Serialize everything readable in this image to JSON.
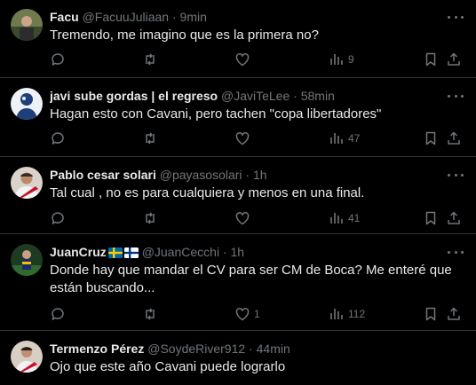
{
  "replies": [
    {
      "name": "Facu",
      "handle": "@FacuuJuliaan",
      "sep": " · ",
      "time": "9min",
      "text": "Tremendo, me imagino que es la primera no?",
      "likes": "",
      "views": "9"
    },
    {
      "name": "javi sube gordas | el regreso",
      "handle": "@JaviTeLee",
      "sep": " · ",
      "time": "58min",
      "text": "Hagan esto con Cavani, pero tachen \"copa libertadores\"",
      "likes": "",
      "views": "47"
    },
    {
      "name": "Pablo cesar solari",
      "handle": "@payasosolari",
      "sep": " · ",
      "time": "1h",
      "text": "Tal cual , no es para cualquiera y menos en una final.",
      "likes": "",
      "views": "41"
    },
    {
      "name": "JuanCruz",
      "handle": "@JuanCecchi",
      "sep": " · ",
      "time": "1h",
      "text": "Donde hay que mandar el CV para ser CM de Boca? Me enteré que están buscando...",
      "likes": "1",
      "views": "112"
    },
    {
      "name": "Termenzo Pérez",
      "handle": "@SoydeRiver912",
      "sep": " · ",
      "time": "44min",
      "text": "Ojo que este año Cavani puede lograrlo",
      "likes": "",
      "views": ""
    }
  ],
  "colors": {
    "background": "#000000",
    "text": "#e7e9ea",
    "muted": "#71767b",
    "divider": "#2f3336"
  },
  "icons": [
    "reply-icon",
    "repost-icon",
    "like-icon",
    "views-icon",
    "bookmark-icon",
    "share-icon",
    "more-icon",
    "sweden-flag-icon",
    "finland-flag-icon"
  ]
}
